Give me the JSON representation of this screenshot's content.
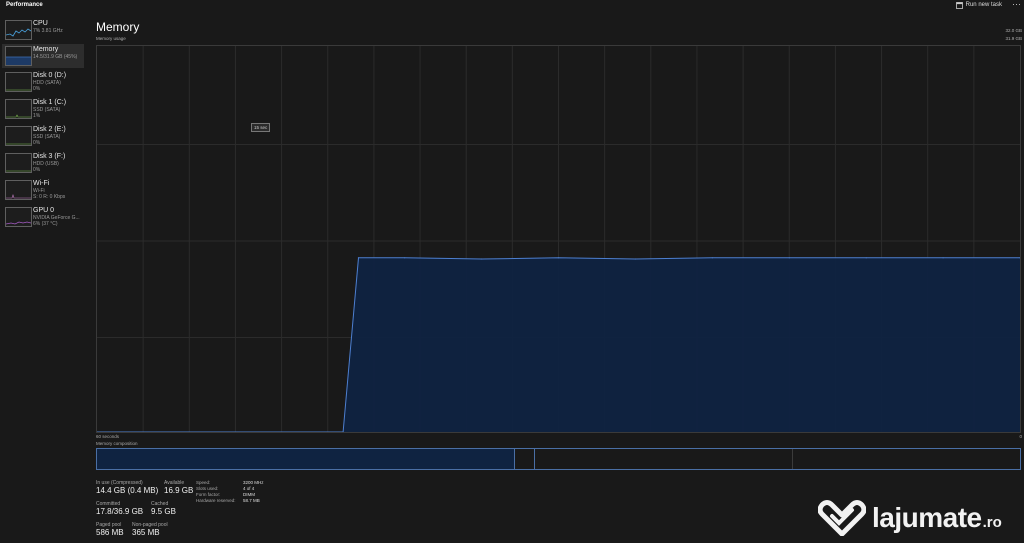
{
  "app": {
    "title": "Performance",
    "run_task_label": "Run new task",
    "more_label": "···"
  },
  "sidebar": {
    "items": [
      {
        "name": "CPU",
        "line1": "7% 3.81 GHz",
        "line2": "",
        "color": "#4aa3df"
      },
      {
        "name": "Memory",
        "line1": "14.5/31.9 GB (45%)",
        "line2": "",
        "color": "#3e6fb8"
      },
      {
        "name": "Disk 0 (D:)",
        "line1": "HDD (SATA)",
        "line2": "0%",
        "color": "#7fbf50"
      },
      {
        "name": "Disk 1 (C:)",
        "line1": "SSD (SATA)",
        "line2": "1%",
        "color": "#7fbf50"
      },
      {
        "name": "Disk 2 (E:)",
        "line1": "SSD (SATA)",
        "line2": "0%",
        "color": "#7fbf50"
      },
      {
        "name": "Disk 3 (F:)",
        "line1": "HDD (USB)",
        "line2": "0%",
        "color": "#7fbf50"
      },
      {
        "name": "Wi-Fi",
        "line1": "Wi-Fi",
        "line2": "S: 0 R: 0 Kbps",
        "color": "#c07cc0"
      },
      {
        "name": "GPU 0",
        "line1": "NVIDIA GeForce G...",
        "line2": "6% (37 °C)",
        "color": "#a65cc7"
      }
    ]
  },
  "main": {
    "title": "Memory",
    "graph_label": "Memory usage",
    "total_top": "32.0 GB",
    "total_sub": "31.9 GB",
    "tooltip": "15 sec",
    "axis_left": "60 seconds",
    "axis_right": "0",
    "composition_label": "Memory composition"
  },
  "chart_data": {
    "type": "area",
    "title": "Memory usage",
    "xlabel": "",
    "ylabel": "",
    "x": [
      60,
      44,
      43,
      40,
      35,
      30,
      25,
      20,
      15,
      10,
      5,
      0
    ],
    "values": [
      0,
      0,
      14.4,
      14.4,
      14.3,
      14.4,
      14.3,
      14.4,
      14.4,
      14.4,
      14.4,
      14.4
    ],
    "xlim": [
      60,
      0
    ],
    "ylim": [
      0,
      31.9
    ],
    "grid": true,
    "fill_color": "#0f2341",
    "line_color": "#4d7fd0"
  },
  "composition": {
    "in_use_fraction": 0.4514,
    "modified_fraction": 0.022,
    "standby_fraction": 0.28,
    "color": "#4a6fa5"
  },
  "stats": {
    "in_use": {
      "label": "In use (Compressed)",
      "value": "14.4 GB (0.4 MB)"
    },
    "available": {
      "label": "Available",
      "value": "16.9 GB"
    },
    "committed": {
      "label": "Committed",
      "value": "17.8/36.9 GB"
    },
    "cached": {
      "label": "Cached",
      "value": "9.5 GB"
    },
    "paged_pool": {
      "label": "Paged pool",
      "value": "586 MB"
    },
    "non_paged_pool": {
      "label": "Non-paged pool",
      "value": "365 MB"
    }
  },
  "specs": {
    "speed": {
      "label": "Speed:",
      "value": "3200 MHz"
    },
    "slots": {
      "label": "Slots used:",
      "value": "4 of 4"
    },
    "form": {
      "label": "Form factor:",
      "value": "DIMM"
    },
    "reserved": {
      "label": "Hardware reserved:",
      "value": "58.7 MB"
    }
  },
  "watermark": {
    "text": "lajumate",
    "suffix": ".ro"
  }
}
